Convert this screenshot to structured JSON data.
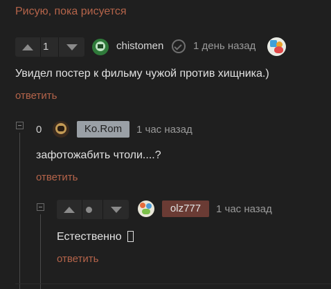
{
  "top_link": "Рисую, пока рисуется",
  "comments": [
    {
      "score": "1",
      "username": "chistomen",
      "time": "1 день назад",
      "text": "Увидел постер к фильму чужой против хищника.)",
      "reply": "ответить"
    },
    {
      "score": "0",
      "username": "Ko.Rom",
      "time": "1 час назад",
      "text": "зафотожабить чтоли....?",
      "reply": "ответить"
    },
    {
      "score": "",
      "username": "olz777",
      "time": "1 час назад",
      "text": "Естественно",
      "reply": "ответить"
    }
  ],
  "colors": {
    "background": "#1f1f1f",
    "reply_link": "#b5644a",
    "badge_korom": "#9aa0a6",
    "badge_olz": "#6a3b34"
  }
}
